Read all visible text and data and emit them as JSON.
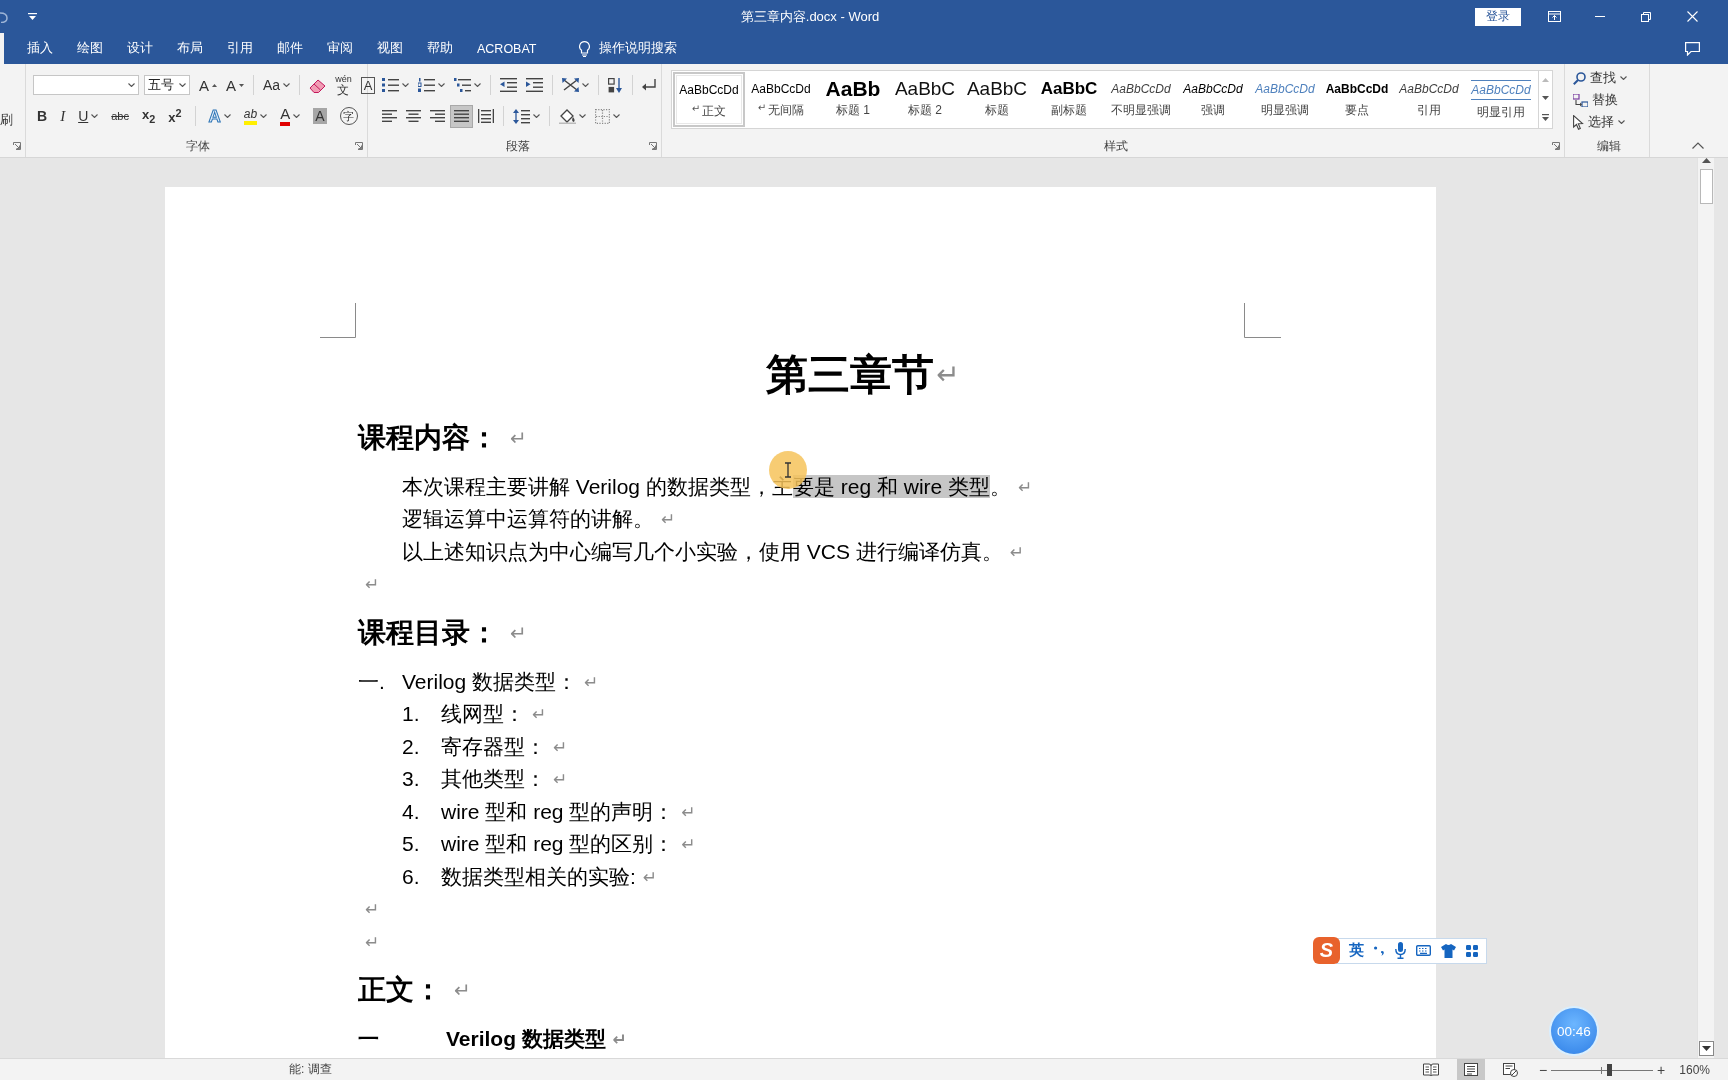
{
  "title_bar": {
    "title": "第三章内容.docx - Word",
    "sign_in": "登录"
  },
  "clipped_tab": {
    "selected": true
  },
  "tabs": [
    {
      "label": "插入",
      "selected": false
    },
    {
      "label": "绘图",
      "selected": false
    },
    {
      "label": "设计",
      "selected": false
    },
    {
      "label": "布局",
      "selected": false
    },
    {
      "label": "引用",
      "selected": false
    },
    {
      "label": "邮件",
      "selected": false
    },
    {
      "label": "审阅",
      "selected": false
    },
    {
      "label": "视图",
      "selected": false
    },
    {
      "label": "帮助",
      "selected": false
    },
    {
      "label": "ACROBAT",
      "selected": false
    }
  ],
  "tell_me": {
    "label": "操作说明搜索"
  },
  "ribbon": {
    "clipboard": {
      "partial_label": "刷"
    },
    "font": {
      "font_size": "五号",
      "row1": [
        {
          "kind": "grow",
          "glyph": "A"
        },
        {
          "kind": "shrink",
          "glyph": "A"
        },
        {
          "kind": "separator"
        },
        {
          "kind": "case",
          "glyph": "Aa",
          "dropdown": true
        },
        {
          "kind": "separator"
        },
        {
          "kind": "clear"
        },
        {
          "kind": "phonetic",
          "glyph": "wén",
          "sub": "文"
        },
        {
          "kind": "border",
          "glyph": "A"
        }
      ],
      "row2": [
        {
          "kind": "bold",
          "glyph": "B"
        },
        {
          "kind": "italic",
          "glyph": "I"
        },
        {
          "kind": "underline",
          "glyph": "U",
          "dropdown": true
        },
        {
          "kind": "strike",
          "glyph": "abc"
        },
        {
          "kind": "subscript",
          "glyph": "x$_{2}$"
        },
        {
          "kind": "superscript",
          "glyph": "x$^{2}$"
        },
        {
          "kind": "separator"
        },
        {
          "kind": "effects",
          "glyph": "A",
          "dropdown": true
        },
        {
          "kind": "highlight",
          "glyph": "ab",
          "dropdown": true
        },
        {
          "kind": "color",
          "glyph": "A",
          "dropdown": true
        },
        {
          "kind": "shading",
          "glyph": "A"
        },
        {
          "kind": "enclose",
          "glyph": "字"
        }
      ],
      "label": "字体"
    },
    "paragraph": {
      "row1": [
        {
          "kind": "bullets",
          "dropdown": true
        },
        {
          "kind": "numbering",
          "dropdown": true
        },
        {
          "kind": "multilevel",
          "dropdown": true
        },
        {
          "kind": "separator"
        },
        {
          "kind": "outdent"
        },
        {
          "kind": "indent"
        },
        {
          "kind": "separator"
        },
        {
          "kind": "asian",
          "dropdown": true
        },
        {
          "kind": "separator"
        },
        {
          "kind": "sort"
        },
        {
          "kind": "separator"
        },
        {
          "kind": "marks"
        }
      ],
      "alignment": [
        {
          "kind": "left",
          "selected": false
        },
        {
          "kind": "center",
          "selected": false
        },
        {
          "kind": "right",
          "selected": false
        },
        {
          "kind": "justify",
          "selected": true
        },
        {
          "kind": "distributed",
          "selected": false
        }
      ],
      "row2": [
        {
          "kind": "separator"
        },
        {
          "kind": "line_spacing",
          "dropdown": true
        },
        {
          "kind": "separator"
        },
        {
          "kind": "shading",
          "dropdown": true
        },
        {
          "kind": "borders",
          "dropdown": true
        }
      ],
      "label": "段落"
    },
    "styles": {
      "items": [
        {
          "kind": "normal",
          "preview": "AaBbCcDd",
          "mark": "↵",
          "label": "正文",
          "selected": true
        },
        {
          "kind": "normal",
          "preview": "AaBbCcDd",
          "mark": "↵",
          "label": "无间隔",
          "selected": false
        },
        {
          "kind": "heading1",
          "preview": "AaBb",
          "label": "标题 1",
          "selected": false
        },
        {
          "kind": "heading2",
          "preview": "AaBbC",
          "label": "标题 2",
          "selected": false
        },
        {
          "kind": "title",
          "preview": "AaBbC",
          "label": "标题",
          "selected": false
        },
        {
          "kind": "subtitle",
          "preview": "AaBbC",
          "label": "副标题",
          "selected": false
        },
        {
          "kind": "subtle",
          "preview": "AaBbCcDd",
          "label": "不明显强调",
          "selected": false
        },
        {
          "kind": "emphasis",
          "preview": "AaBbCcDd",
          "label": "强调",
          "selected": false
        },
        {
          "kind": "intense",
          "preview": "AaBbCcDd",
          "label": "明显强调",
          "selected": false
        },
        {
          "kind": "strong",
          "preview": "AaBbCcDd",
          "label": "要点",
          "selected": false
        },
        {
          "kind": "quote",
          "preview": "AaBbCcDd",
          "label": "引用",
          "selected": false
        },
        {
          "kind": "intense_quote",
          "preview": "AaBbCcDd",
          "label": "明显引用",
          "selected": false
        }
      ],
      "label": "样式"
    },
    "editing": {
      "items": [
        {
          "kind": "find",
          "label": "查找",
          "dropdown": true
        },
        {
          "kind": "replace",
          "label": "替换"
        },
        {
          "kind": "select",
          "label": "选择",
          "dropdown": true
        }
      ],
      "label": "编辑"
    }
  },
  "document": {
    "title": {
      "text": "第三章节",
      "mark": "↵"
    },
    "blocks": [
      {
        "kind": "heading",
        "text": "课程内容：",
        "mark": "↵"
      },
      {
        "kind": "paragraph",
        "segments": [
          {
            "text": "本次课程主要讲解 Verilog 的数据类型，主",
            "selected": false
          },
          {
            "text": "要是 reg 和 wire 类型",
            "selected": true
          },
          {
            "text": "。",
            "selected": false
          }
        ],
        "mark": "↵"
      },
      {
        "kind": "paragraph",
        "segments": [
          {
            "text": "逻辑运算中运算符的讲解。",
            "selected": false
          }
        ],
        "mark": "↵"
      },
      {
        "kind": "paragraph",
        "segments": [
          {
            "text": "以上述知识点为中心编写几个小实验，使用 VCS 进行编译仿真。",
            "selected": false
          }
        ],
        "mark": "↵"
      },
      {
        "kind": "empty",
        "mark": "↵"
      },
      {
        "kind": "heading",
        "text": "课程目录：",
        "mark": "↵"
      },
      {
        "kind": "list",
        "number": "一.",
        "text": "Verilog 数据类型：",
        "mark": "↵",
        "children": [
          {
            "number": "1.",
            "text": "线网型：",
            "mark": "↵"
          },
          {
            "number": "2.",
            "text": "寄存器型：",
            "mark": "↵"
          },
          {
            "number": "3.",
            "text": "其他类型：",
            "mark": "↵"
          },
          {
            "number": "4.",
            "text": "wire 型和 reg 型的声明：",
            "mark": "↵"
          },
          {
            "number": "5.",
            "text": "wire 型和 reg 型的区别：",
            "mark": "↵"
          },
          {
            "number": "6.",
            "text": "数据类型相关的实验:",
            "mark": "↵"
          }
        ]
      },
      {
        "kind": "empty",
        "mark": "↵"
      },
      {
        "kind": "empty",
        "mark": "↵"
      },
      {
        "kind": "heading",
        "text": "正文：",
        "mark": "↵"
      },
      {
        "kind": "section",
        "number": "一",
        "text": "Verilog 数据类型",
        "mark": "↵"
      }
    ]
  },
  "ime_toolbar": {
    "logo": "S",
    "mode": "英"
  },
  "recording_timer": {
    "time": "00:46"
  },
  "status_bar": {
    "text": "能: 调查",
    "views": [
      {
        "kind": "read",
        "selected": false
      },
      {
        "kind": "print",
        "selected": true
      },
      {
        "kind": "web",
        "selected": false
      }
    ],
    "zoom": {
      "minus": "−",
      "plus": "+",
      "level": 0.57,
      "reading": "160%"
    }
  }
}
